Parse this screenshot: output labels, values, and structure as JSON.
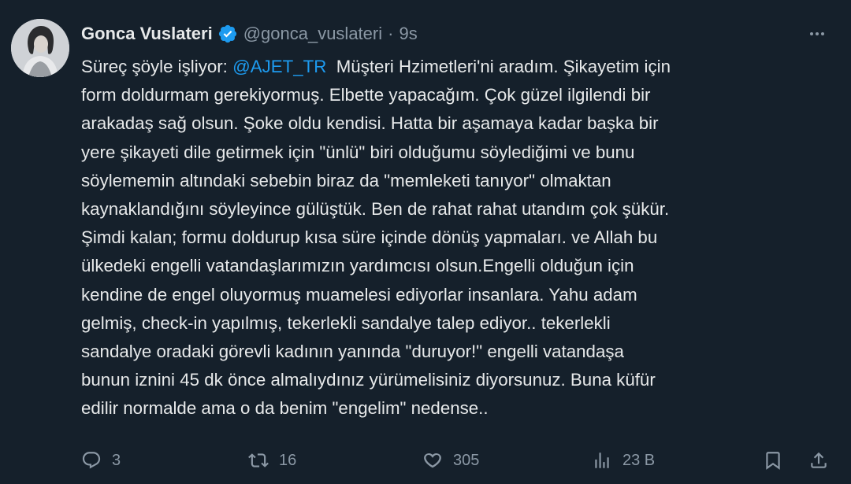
{
  "tweet": {
    "display_name": "Gonca Vuslateri",
    "handle": "@gonca_vuslateri",
    "separator": "·",
    "time": "9s",
    "lines": [
      {
        "pre": "Süreç şöyle işliyor: ",
        "mention": "@AJET_TR",
        "post": "  Müşteri Hzimetleri'ni aradım. Şikayetim için"
      },
      {
        "text": "form doldurmam gerekiyormuş. Elbette yapacağım. Çok güzel ilgilendi bir"
      },
      {
        "text": "arakadaş sağ olsun. Şoke oldu kendisi. Hatta bir aşamaya kadar başka bir"
      },
      {
        "text": "yere şikayeti dile getirmek için \"ünlü\" biri olduğumu söylediğimi ve bunu"
      },
      {
        "text": "söylememin altındaki sebebin biraz da \"memleketi tanıyor\" olmaktan"
      },
      {
        "text": "kaynaklandığını söyleyince gülüştük. Ben de rahat rahat utandım çok şükür."
      },
      {
        "text": "Şimdi kalan; formu doldurup kısa süre içinde dönüş yapmaları. ve Allah bu"
      },
      {
        "text": "ülkedeki engelli vatandaşlarımızın yardımcısı olsun.Engelli olduğun için"
      },
      {
        "text": "kendine de engel oluyormuş muamelesi ediyorlar insanlara. Yahu adam"
      },
      {
        "text": "gelmiş, check-in yapılmış, tekerlekli sandalye talep ediyor.. tekerlekli"
      },
      {
        "text": "sandalye oradaki görevli kadının yanında \"duruyor!\" engelli vatandaşa"
      },
      {
        "text": "bunun iznini 45 dk önce almalıydınız yürümelisiniz diyorsunuz. Buna küfür"
      },
      {
        "text": "edilir normalde ama o da benim \"engelim\" nedense.."
      }
    ]
  },
  "actions": {
    "reply": {
      "icon": "reply-icon",
      "count": "3"
    },
    "retweet": {
      "icon": "retweet-icon",
      "count": "16"
    },
    "like": {
      "icon": "heart-icon",
      "count": "305"
    },
    "views": {
      "icon": "views-icon",
      "count": "23 B"
    },
    "bookmark": {
      "icon": "bookmark-icon"
    },
    "share": {
      "icon": "share-icon"
    }
  },
  "colors": {
    "background": "#15202b",
    "text": "#e7e9ea",
    "secondary": "#8b98a5",
    "accent": "#1d9bf0"
  }
}
